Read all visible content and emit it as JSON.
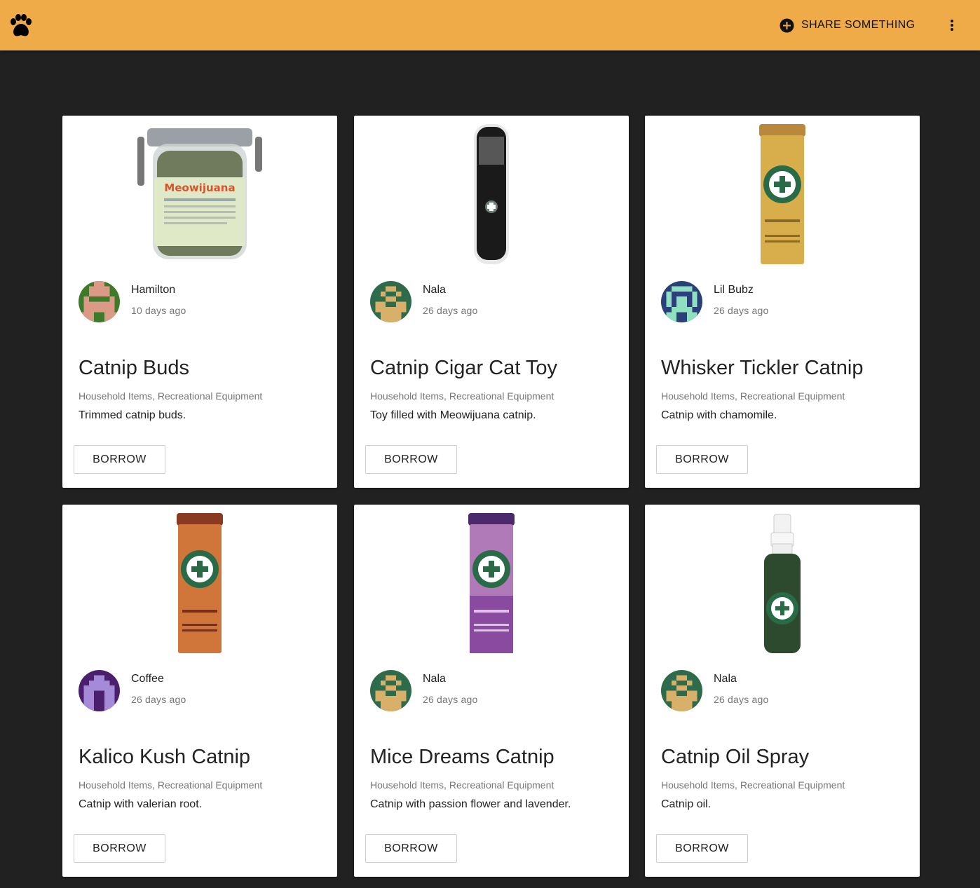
{
  "header": {
    "logo_icon": "paw-icon",
    "share_label": "SHARE SOMETHING",
    "share_icon": "add-circle-icon",
    "more_icon": "more-vert-icon",
    "accent_color": "#efab47"
  },
  "cards": [
    {
      "owner": "Hamilton",
      "time": "10 days ago",
      "title": "Catnip Buds",
      "tags": "Household Items, Recreational Equipment",
      "description": "Trimmed catnip buds.",
      "button": "BORROW"
    },
    {
      "owner": "Nala",
      "time": "26 days ago",
      "title": "Catnip Cigar Cat Toy",
      "tags": "Household Items, Recreational Equipment",
      "description": "Toy filled with Meowijuana catnip.",
      "button": "BORROW"
    },
    {
      "owner": "Lil Bubz",
      "time": "26 days ago",
      "title": "Whisker Tickler Catnip",
      "tags": "Household Items, Recreational Equipment",
      "description": "Catnip with chamomile.",
      "button": "BORROW"
    },
    {
      "owner": "Coffee",
      "time": "26 days ago",
      "title": "Kalico Kush Catnip",
      "tags": "Household Items, Recreational Equipment",
      "description": "Catnip with valerian root.",
      "button": "BORROW"
    },
    {
      "owner": "Nala",
      "time": "26 days ago",
      "title": "Mice Dreams Catnip",
      "tags": "Household Items, Recreational Equipment",
      "description": "Catnip with passion flower and lavender.",
      "button": "BORROW"
    },
    {
      "owner": "Nala",
      "time": "26 days ago",
      "title": "Catnip Oil Spray",
      "tags": "Household Items, Recreational Equipment",
      "description": "Catnip oil.",
      "button": "BORROW"
    }
  ]
}
